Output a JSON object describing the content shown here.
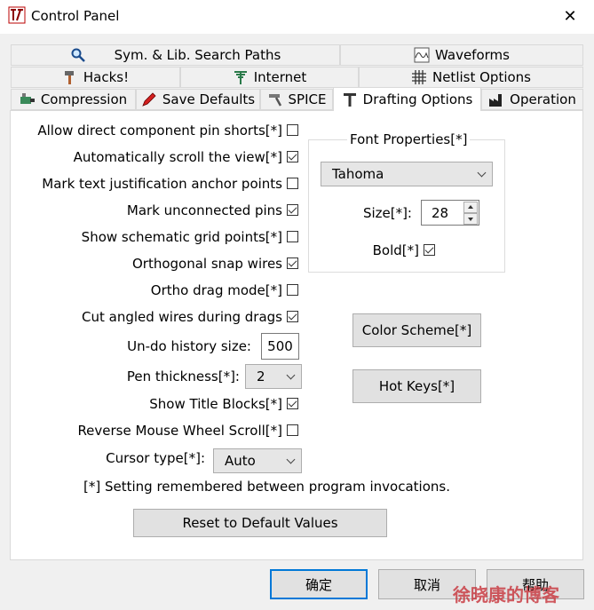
{
  "window": {
    "title": "Control Panel",
    "close": "✕"
  },
  "tabs": {
    "row1": [
      {
        "label": "Sym. & Lib. Search Paths",
        "icon": "magnifier-icon"
      },
      {
        "label": "Waveforms",
        "icon": "waveform-icon"
      }
    ],
    "row2": [
      {
        "label": "Hacks!",
        "icon": "hammer-icon"
      },
      {
        "label": "Internet",
        "icon": "antenna-icon"
      },
      {
        "label": "Netlist Options",
        "icon": "netlist-grid-icon"
      }
    ],
    "row3": [
      {
        "label": "Compression",
        "icon": "compression-icon"
      },
      {
        "label": "Save Defaults",
        "icon": "pencil-icon"
      },
      {
        "label": "SPICE",
        "icon": "hammer-icon"
      },
      {
        "label": "Drafting Options",
        "icon": "drafting-t-icon",
        "active": true
      },
      {
        "label": "Operation",
        "icon": "factory-icon"
      }
    ]
  },
  "options": [
    {
      "label": "Allow direct component pin shorts[*]",
      "checked": false
    },
    {
      "label": "Automatically scroll the view[*]",
      "checked": true
    },
    {
      "label": "Mark text justification anchor points",
      "checked": false
    },
    {
      "label": "Mark unconnected pins",
      "checked": true
    },
    {
      "label": "Show schematic grid points[*]",
      "checked": false
    },
    {
      "label": "Orthogonal snap wires",
      "checked": true
    },
    {
      "label": "Ortho drag mode[*]",
      "checked": false
    },
    {
      "label": "Cut angled wires during drags",
      "checked": true
    }
  ],
  "undo": {
    "label": "Un-do history size:",
    "value": "500"
  },
  "pen": {
    "label": "Pen thickness[*]:",
    "value": "2"
  },
  "options2": [
    {
      "label": "Show Title Blocks[*]",
      "checked": true
    },
    {
      "label": "Reverse Mouse Wheel Scroll[*]",
      "checked": false
    }
  ],
  "cursor": {
    "label": "Cursor type[*]:",
    "value": "Auto"
  },
  "note": "[*] Setting remembered between program invocations.",
  "reset_label": "Reset to Default Values",
  "font": {
    "group_title": "Font Properties[*]",
    "family": "Tahoma",
    "size_label": "Size[*]:",
    "size": "28",
    "bold_label": "Bold[*]",
    "bold": true
  },
  "color_scheme_label": "Color Scheme[*]",
  "hot_keys_label": "Hot Keys[*]",
  "footer": {
    "ok": "确定",
    "cancel": "取消",
    "help": "帮助"
  },
  "watermark": "徐晓康的博客",
  "colors": {
    "accent": "#0078d7",
    "panel": "#ffffff",
    "window": "#f0f0f0"
  }
}
